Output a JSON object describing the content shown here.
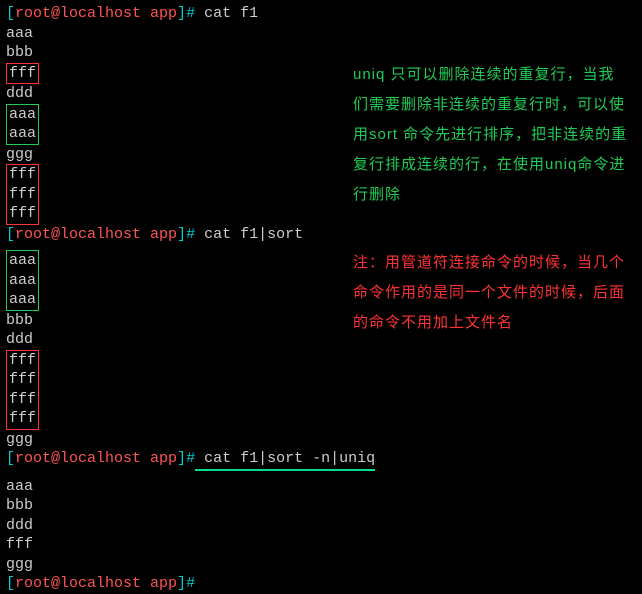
{
  "prompt": {
    "lb": "[",
    "userhost": "root@localhost app",
    "rb": "]",
    "hash": "#"
  },
  "cmd1": " cat f1",
  "out1": {
    "l1": "aaa",
    "l2": "bbb",
    "l3": "fff",
    "l4": "ddd",
    "l5": "aaa",
    "l6": "aaa",
    "l7": "ggg",
    "l8": "fff",
    "l9": "fff",
    "l10": "fff"
  },
  "cmd2": " cat f1|sort",
  "out2": {
    "l1": "aaa",
    "l2": "aaa",
    "l3": "aaa",
    "l4": "bbb",
    "l5": "ddd",
    "l6": "fff",
    "l7": "fff",
    "l8": "fff",
    "l9": "fff",
    "l10": "ggg"
  },
  "cmd3": " cat f1|sort -n|uniq",
  "out3": {
    "l1": "aaa",
    "l2": "bbb",
    "l3": "ddd",
    "l4": "fff",
    "l5": "ggg"
  },
  "note_green": "uniq 只可以删除连续的重复行，当我们需要删除非连续的重复行时，可以使用sort 命令先进行排序，把非连续的重复行排成连续的行，在使用uniq命令进行删除",
  "note_red": "注：用管道符连接命令的时候，当几个命令作用的是同一个文件的时候，后面的命令不用加上文件名"
}
